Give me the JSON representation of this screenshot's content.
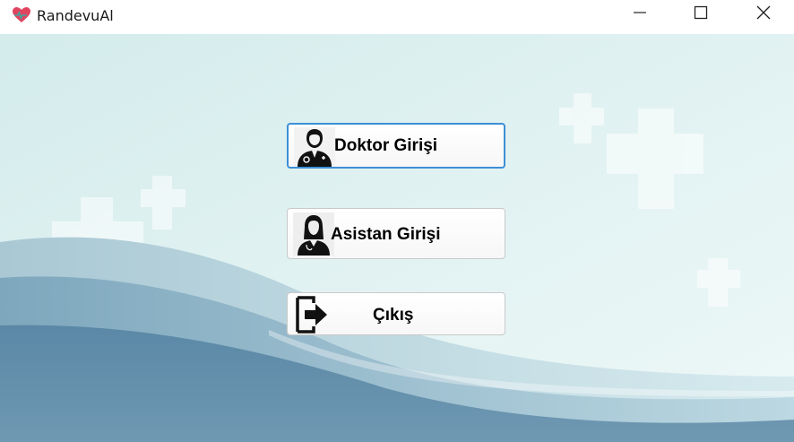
{
  "window": {
    "title": "RandevuAl",
    "app_icon": "heart-icon",
    "controls": [
      "minimize-icon",
      "maximize-icon",
      "close-icon"
    ]
  },
  "buttons": {
    "doktor": {
      "label": "Doktor Girişi",
      "icon": "doctor-icon"
    },
    "asistan": {
      "label": "Asistan Girişi",
      "icon": "nurse-icon"
    },
    "cikis": {
      "label": "Çıkış",
      "icon": "exit-icon"
    }
  },
  "colors": {
    "focus_border": "#3d8fd6",
    "background_light": "#e6f4f4",
    "wave_dark": "#4f7d9c",
    "heart": "#e0445f"
  }
}
